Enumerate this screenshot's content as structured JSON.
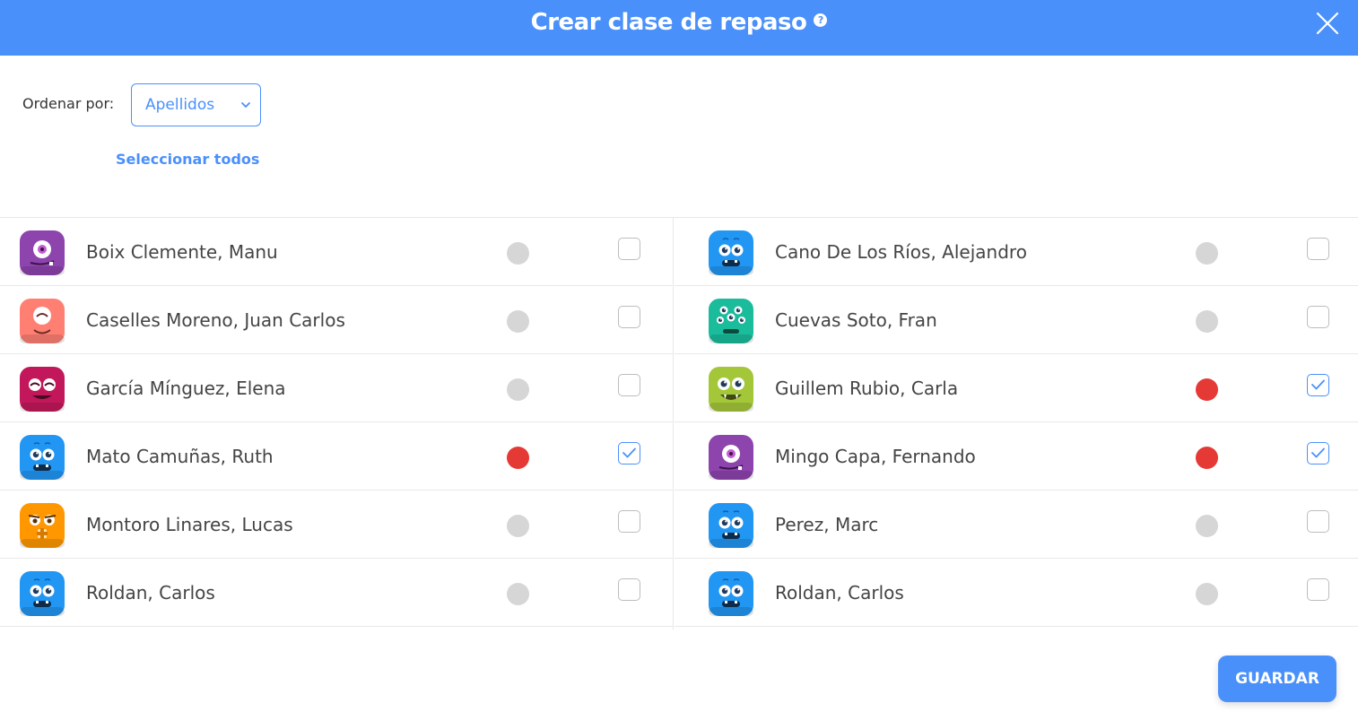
{
  "dialog": {
    "title": "Crear clase de repaso",
    "help_glyph": "?",
    "accent_color": "#4a90fb"
  },
  "sort": {
    "label": "Ordenar por:",
    "selected": "Apellidos"
  },
  "select_all_label": "Seleccionar todos",
  "save_label": "GUARDAR",
  "status_colors": {
    "active": "#e53935",
    "inactive": "#d6d6d6"
  },
  "students_left": [
    {
      "name": "Boix Clemente, Manu",
      "avatar": "purple-cyclops-monster",
      "active": false,
      "checked": false
    },
    {
      "name": "Caselles Moreno, Juan Carlos",
      "avatar": "pink-happy-monster",
      "active": false,
      "checked": false
    },
    {
      "name": "García Mínguez, Elena",
      "avatar": "magenta-smiling-monster",
      "active": false,
      "checked": false
    },
    {
      "name": "Mato Camuñas, Ruth",
      "avatar": "blue-monster",
      "active": true,
      "checked": true
    },
    {
      "name": "Montoro Linares, Lucas",
      "avatar": "orange-bandage-monster",
      "active": false,
      "checked": false
    },
    {
      "name": "Roldan, Carlos",
      "avatar": "blue-monster",
      "active": false,
      "checked": false
    }
  ],
  "students_right": [
    {
      "name": "Cano De Los Ríos, Alejandro",
      "avatar": "blue-monster",
      "active": false,
      "checked": false
    },
    {
      "name": "Cuevas Soto, Fran",
      "avatar": "teal-four-eyed-monster",
      "active": false,
      "checked": false
    },
    {
      "name": "Guillem Rubio, Carla",
      "avatar": "lime-fanged-monster",
      "active": true,
      "checked": true
    },
    {
      "name": "Mingo Capa, Fernando",
      "avatar": "purple-cyclops-monster",
      "active": true,
      "checked": true
    },
    {
      "name": "Perez, Marc",
      "avatar": "blue-monster",
      "active": false,
      "checked": false
    },
    {
      "name": "Roldan, Carlos",
      "avatar": "blue-monster",
      "active": false,
      "checked": false
    }
  ]
}
